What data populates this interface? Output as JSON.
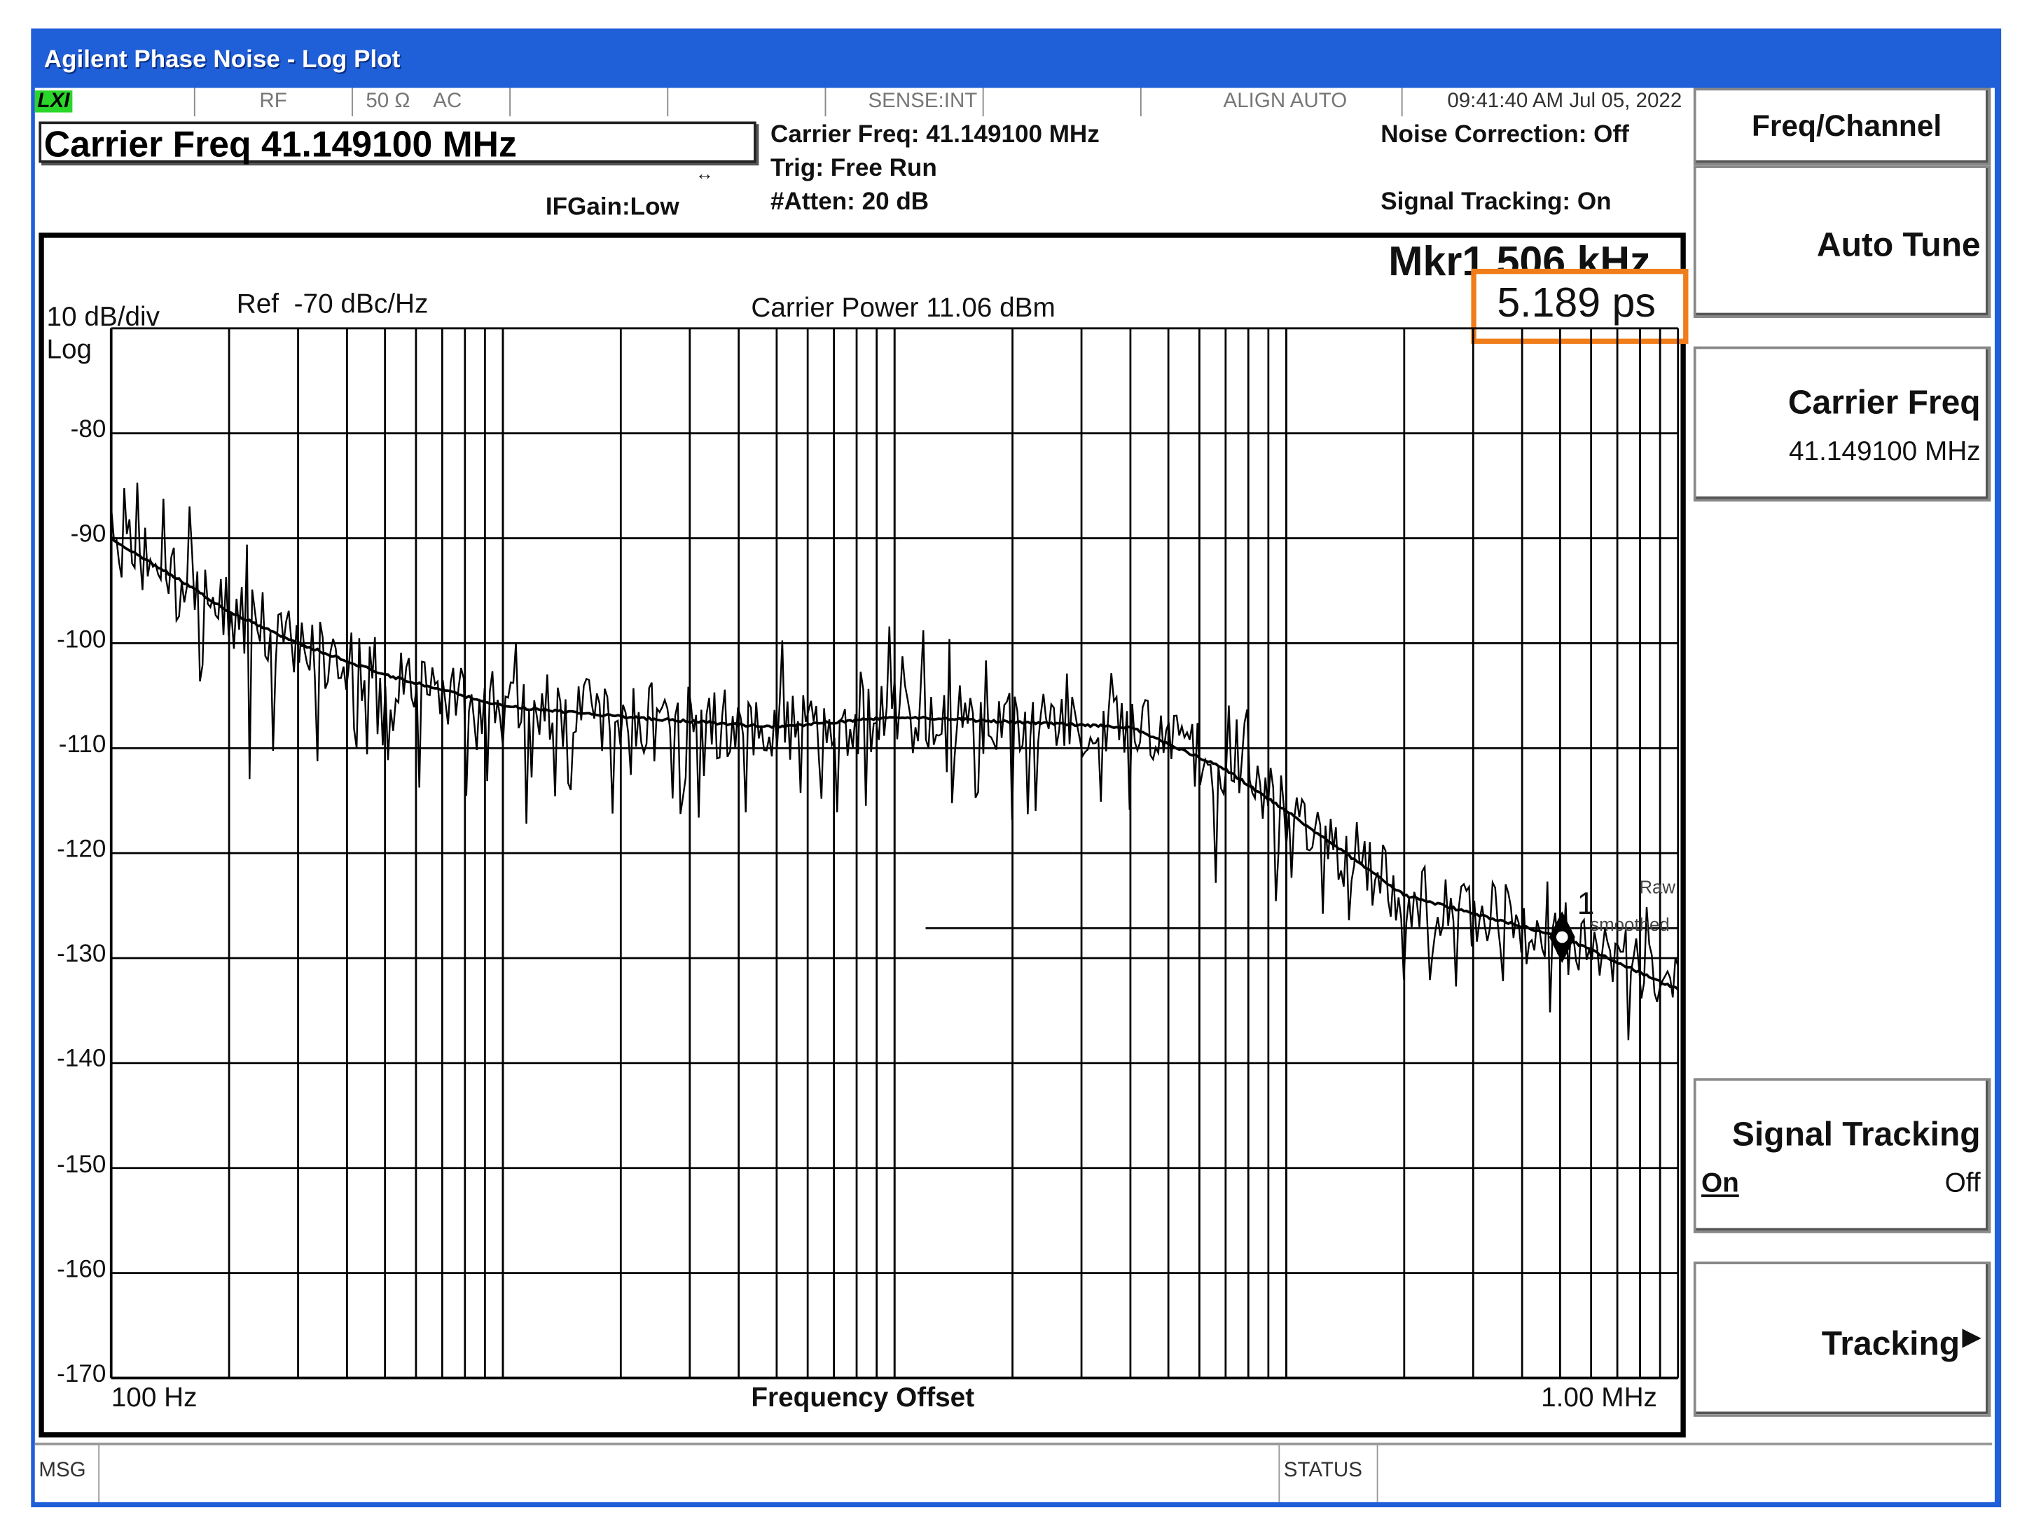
{
  "window": {
    "title": "Agilent Phase Noise - Log Plot"
  },
  "status_row": {
    "lxi": "LXI",
    "rf": "RF",
    "impedance": "50 Ω",
    "coupling": "AC",
    "sense": "SENSE:INT",
    "align": "ALIGN AUTO",
    "datetime": "09:41:40 AM Jul 05, 2022"
  },
  "header": {
    "active_function": "Carrier Freq 41.149100 MHz",
    "carrier_freq": "Carrier Freq: 41.149100 MHz",
    "trig": "Trig: Free Run",
    "atten": "#Atten: 20 dB",
    "if_gain": "IFGain:Low",
    "noise_correction": "Noise Correction: Off",
    "signal_tracking": "Signal Tracking: On"
  },
  "plot": {
    "scale": "10 dB/div",
    "scale_type": "Log",
    "ref": "Ref  -70 dBc/Hz",
    "carrier_power": "Carrier Power 11.06 dBm",
    "marker_freq": "Mkr1 506 kHz",
    "marker_value": "5.189 ps",
    "x_start": "100 Hz",
    "x_label": "Frequency Offset",
    "x_stop": "1.00 MHz",
    "marker_id": "1",
    "raw_label": "Raw",
    "smoothed_label": "smoothed",
    "highlight_color": "#f07d1a"
  },
  "chart_data": {
    "type": "line",
    "xscale": "log",
    "xlim": [
      100,
      1000000
    ],
    "ylim": [
      -170,
      -70
    ],
    "yticks": [
      -80,
      -90,
      -100,
      -110,
      -120,
      -130,
      -140,
      -150,
      -160,
      -170
    ],
    "ylabel": "dBc/Hz",
    "xlabel": "Frequency Offset",
    "smoothed": {
      "x": [
        100,
        150,
        200,
        300,
        500,
        1000,
        2000,
        5000,
        10000,
        20000,
        40000,
        70000,
        100000,
        200000,
        506000,
        1000000
      ],
      "y": [
        -90,
        -94,
        -97,
        -100,
        -103,
        -106,
        -107,
        -108,
        -107,
        -107.5,
        -108,
        -112,
        -116,
        -124,
        -128,
        -133
      ]
    },
    "marker": {
      "x": 506000,
      "y": -128,
      "label": "1"
    }
  },
  "softkeys": {
    "title": "Freq/Channel",
    "auto_tune": "Auto Tune",
    "carrier_freq": "Carrier Freq",
    "carrier_freq_value": "41.149100 MHz",
    "signal_tracking": "Signal Tracking",
    "on": "On",
    "off": "Off",
    "tracking": "Tracking"
  },
  "statusbar": {
    "msg": "MSG",
    "status": "STATUS"
  }
}
